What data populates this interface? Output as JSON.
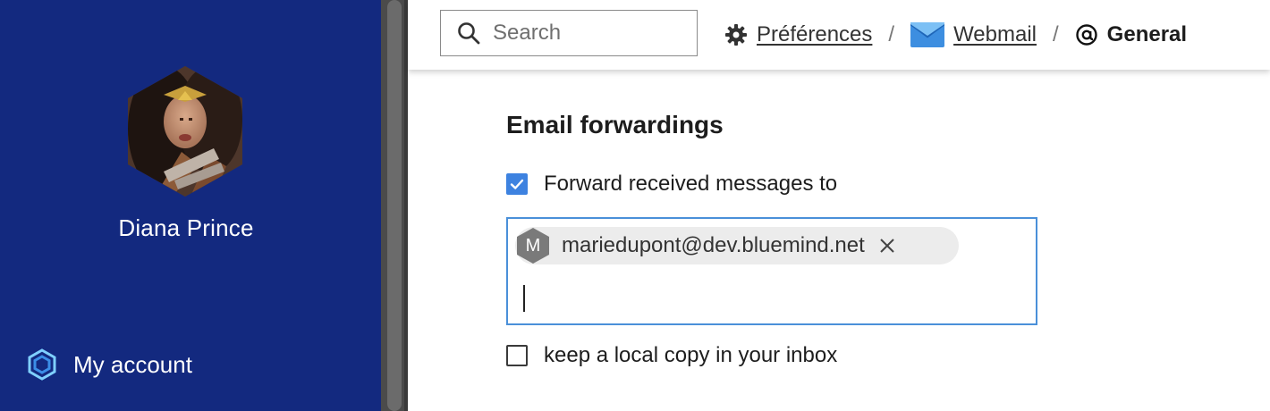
{
  "user": {
    "name": "Diana Prince"
  },
  "sidebar": {
    "account_label": "My account"
  },
  "header": {
    "search": {
      "placeholder": "Search",
      "value": ""
    },
    "breadcrumb": [
      {
        "label": "Préférences",
        "icon": "gear-icon"
      },
      {
        "label": "Webmail",
        "icon": "envelope-icon"
      },
      {
        "label": "General",
        "icon": "at-sign-icon"
      }
    ],
    "separator": "/"
  },
  "forwarding": {
    "title": "Email forwardings",
    "forward_label": "Forward received messages to",
    "forward_checked": true,
    "recipients": [
      {
        "initial": "M",
        "email": "mariedupont@dev.bluemind.net"
      }
    ],
    "keep_copy_label": "keep a local copy in your inbox",
    "keep_copy_checked": false
  },
  "colors": {
    "sidebar_bg": "#13297f",
    "accent": "#3d82e0",
    "input_focus": "#4a90d9"
  }
}
